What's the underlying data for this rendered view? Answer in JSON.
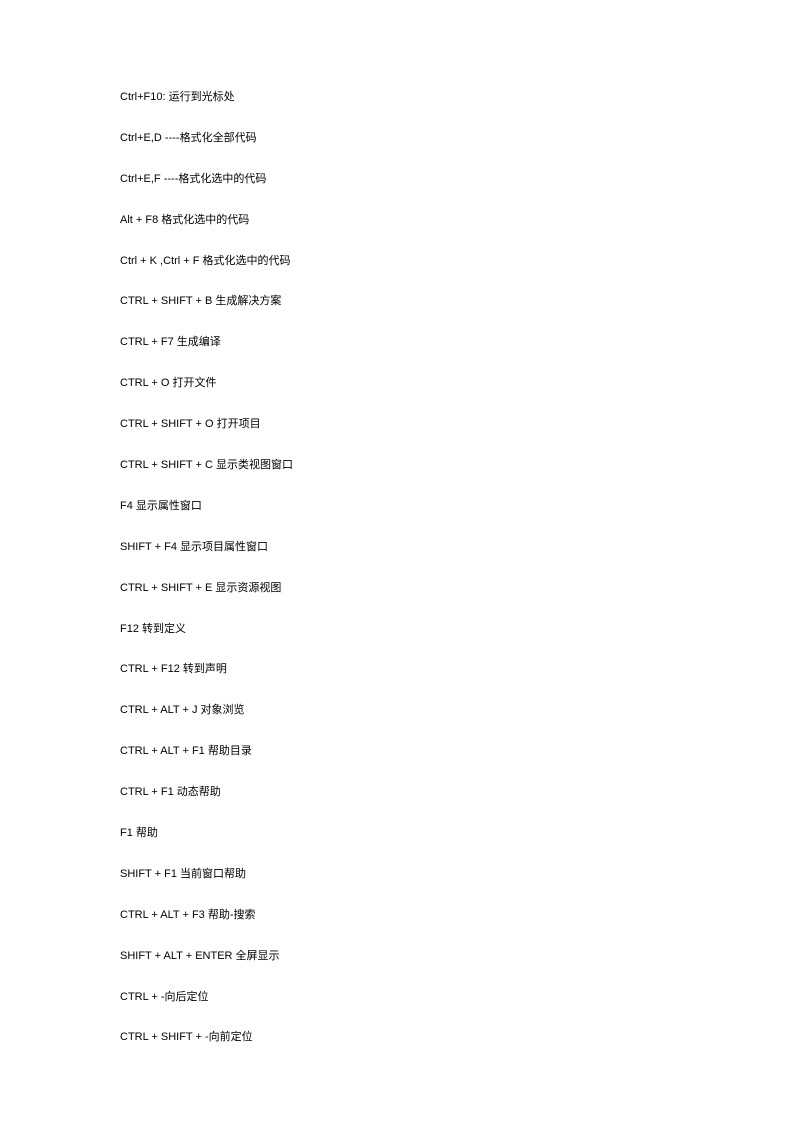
{
  "lines": [
    "Ctrl+F10:  运行到光标处",
    "Ctrl+E,D ----格式化全部代码",
    "Ctrl+E,F ----格式化选中的代码",
    "Alt + F8 格式化选中的代码",
    "Ctrl + K ,Ctrl + F  格式化选中的代码",
    "CTRL + SHIFT + B 生成解决方案",
    "CTRL + F7  生成编译",
    "CTRL + O  打开文件",
    "CTRL + SHIFT + O 打开项目",
    "CTRL + SHIFT + C 显示类视图窗口",
    "F4  显示属性窗口",
    "SHIFT + F4 显示项目属性窗口",
    "CTRL + SHIFT + E 显示资源视图",
    "F12  转到定义",
    "CTRL + F12 转到声明",
    "CTRL + ALT + J 对象浏览",
    "CTRL + ALT + F1 帮助目录",
    "CTRL + F1  动态帮助",
    "F1  帮助",
    "SHIFT + F1 当前窗口帮助",
    "CTRL + ALT + F3 帮助-搜索",
    "SHIFT + ALT + ENTER 全屏显示",
    "CTRL + -向后定位",
    "CTRL + SHIFT + -向前定位"
  ]
}
